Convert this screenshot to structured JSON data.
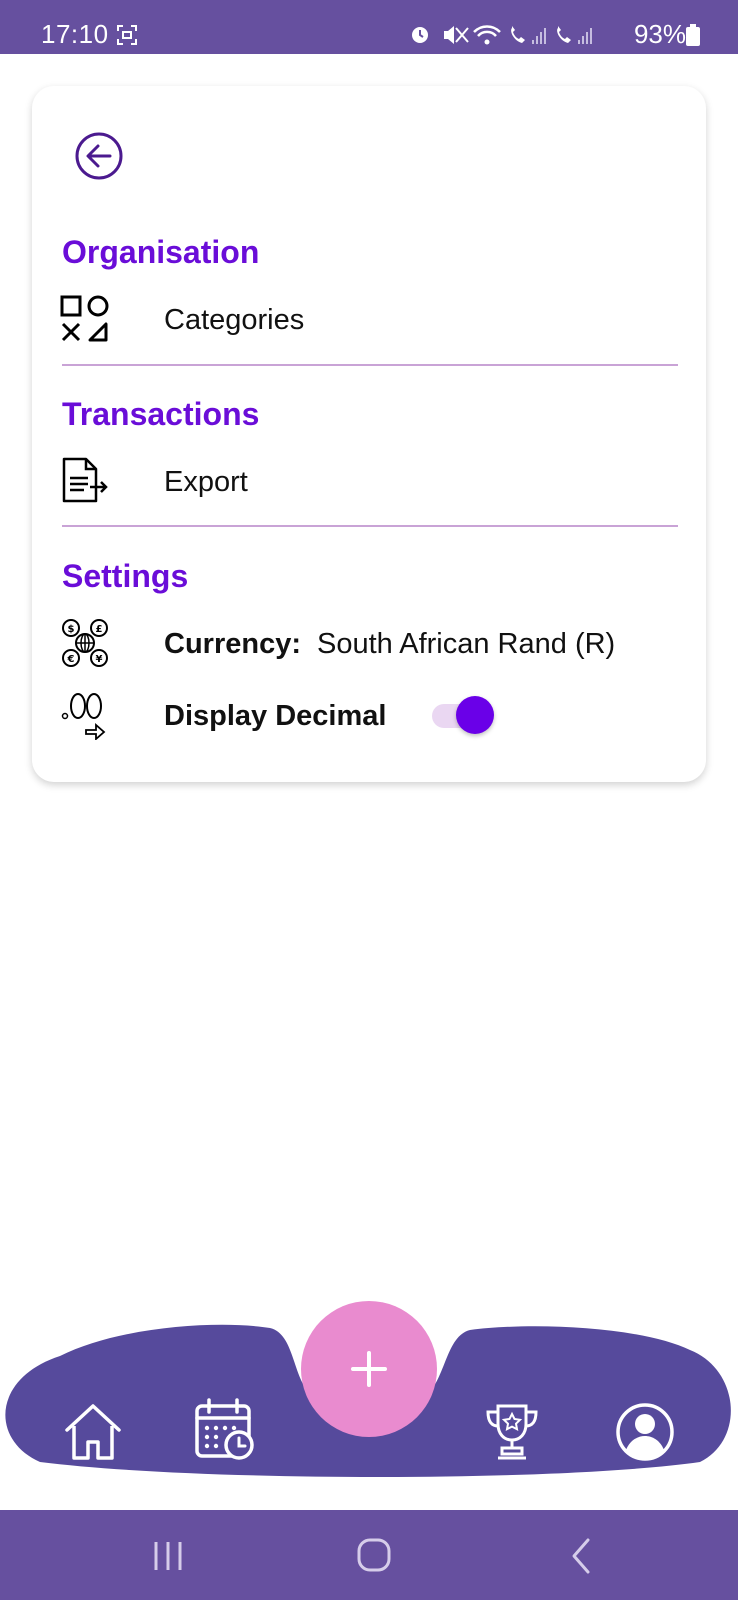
{
  "status_bar": {
    "time": "17:10",
    "battery": "93%"
  },
  "settings": {
    "sections": [
      {
        "title": "Organisation",
        "item": "Categories"
      },
      {
        "title": "Transactions",
        "item": "Export"
      },
      {
        "title": "Settings"
      }
    ],
    "currency": {
      "label": "Currency:",
      "value": "South African Rand (R)"
    },
    "display_decimal": {
      "label": "Display Decimal",
      "enabled": true
    }
  },
  "icons": {
    "back": "back-arrow-icon",
    "categories": "shapes-icon",
    "export": "document-export-icon",
    "currency": "currency-exchange-icon",
    "decimal": "decimal-icon",
    "home": "home-icon",
    "calendar": "calendar-icon",
    "add": "plus-icon",
    "trophy": "trophy-icon",
    "profile": "profile-icon"
  },
  "colors": {
    "brand": "#66509f",
    "nav_bar": "#564a9c",
    "accent": "#6a0dd8",
    "fab": "#e98bcf",
    "toggle_on": "#6a00e8",
    "divider": "#c9a3d6"
  }
}
